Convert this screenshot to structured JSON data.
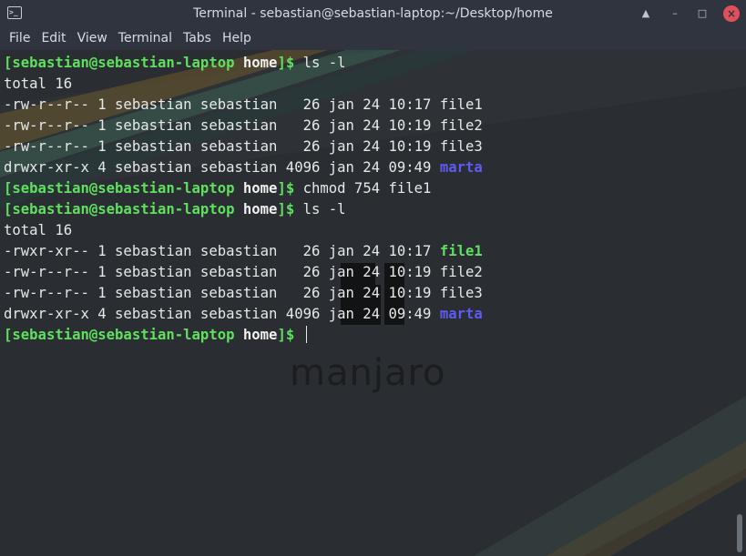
{
  "window": {
    "title": "Terminal - sebastian@sebastian-laptop:~/Desktop/home",
    "app_icon": ">_",
    "controls": {
      "minimize": "▲",
      "restore": "–",
      "maximize": "□",
      "close": "×"
    }
  },
  "menu": [
    "File",
    "Edit",
    "View",
    "Terminal",
    "Tabs",
    "Help"
  ],
  "watermark": "manjaro",
  "terminal": {
    "prompt_user": "[sebastian@sebastian-laptop",
    "prompt_dir": "home",
    "prompt_end": "]$",
    "lines": [
      {
        "kind": "prompt",
        "cmd": " ls -l"
      },
      {
        "kind": "text",
        "text": "total 16"
      },
      {
        "kind": "ls",
        "prefix": "-rw-r--r-- 1 sebastian sebastian   26 jan 24 10:17 ",
        "name": "file1",
        "type": "file"
      },
      {
        "kind": "ls",
        "prefix": "-rw-r--r-- 1 sebastian sebastian   26 jan 24 10:19 ",
        "name": "file2",
        "type": "file"
      },
      {
        "kind": "ls",
        "prefix": "-rw-r--r-- 1 sebastian sebastian   26 jan 24 10:19 ",
        "name": "file3",
        "type": "file"
      },
      {
        "kind": "ls",
        "prefix": "drwxr-xr-x 4 sebastian sebastian 4096 jan 24 09:49 ",
        "name": "marta",
        "type": "dir"
      },
      {
        "kind": "prompt",
        "cmd": " chmod 754 file1"
      },
      {
        "kind": "prompt",
        "cmd": " ls -l"
      },
      {
        "kind": "text",
        "text": "total 16"
      },
      {
        "kind": "ls",
        "prefix": "-rwxr-xr-- 1 sebastian sebastian   26 jan 24 10:17 ",
        "name": "file1",
        "type": "exec"
      },
      {
        "kind": "ls",
        "prefix": "-rw-r--r-- 1 sebastian sebastian   26 jan 24 10:19 ",
        "name": "file2",
        "type": "file"
      },
      {
        "kind": "ls",
        "prefix": "-rw-r--r-- 1 sebastian sebastian   26 jan 24 10:19 ",
        "name": "file3",
        "type": "file"
      },
      {
        "kind": "ls",
        "prefix": "drwxr-xr-x 4 sebastian sebastian 4096 jan 24 09:49 ",
        "name": "marta",
        "type": "dir"
      },
      {
        "kind": "prompt",
        "cmd": " ",
        "cursor": true
      }
    ]
  },
  "colors": {
    "prompt_green": "#5fe05f",
    "directory_blue": "#5c5cf2",
    "text": "#e6e8ea",
    "close_button": "#e0505a",
    "titlebar": "#2f343f"
  }
}
